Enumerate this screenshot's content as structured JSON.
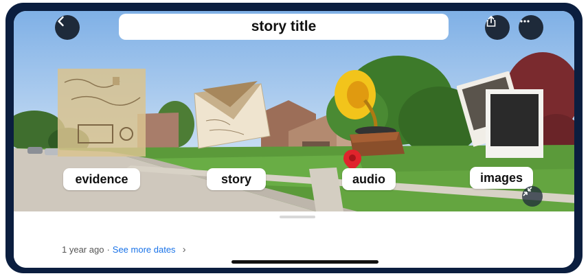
{
  "header": {
    "title": "story title",
    "back_icon": "chevron-left-icon",
    "share_icon": "share-icon",
    "more_icon": "more-horizontal-icon"
  },
  "items": [
    {
      "label": "evidence",
      "icon": "old-letters-icon"
    },
    {
      "label": "story",
      "icon": "envelope-icon"
    },
    {
      "label": "audio",
      "icon": "gramophone-icon"
    },
    {
      "label": "images",
      "icon": "polaroid-photos-icon"
    }
  ],
  "scene": {
    "pin_icon": "location-pin-icon",
    "collapse_icon": "minimize-icon",
    "pin_color": "#e0242c"
  },
  "sheet": {
    "age": "1 year ago",
    "separator": "·",
    "see_more": "See more dates",
    "chevron": "›"
  }
}
